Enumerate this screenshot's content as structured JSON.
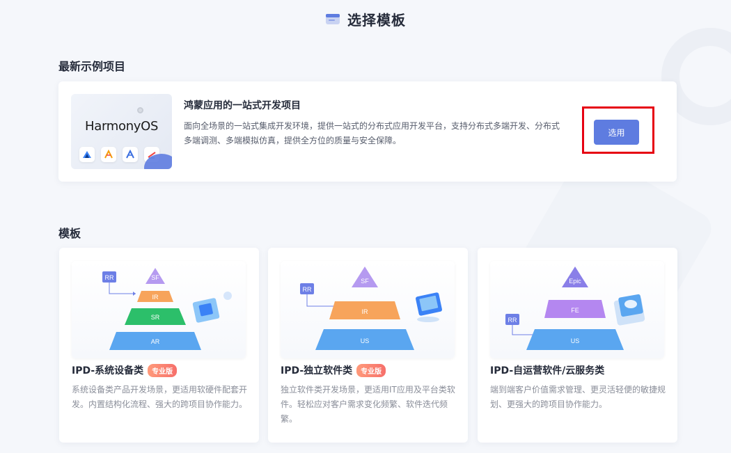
{
  "header": {
    "title": "选择模板",
    "icon": "template-icon"
  },
  "latest": {
    "section_title": "最新示例项目",
    "project": {
      "logo_text": "HarmonyOS",
      "title": "鸿蒙应用的一站式开发项目",
      "description": "面向全场景的一站式集成开发环境，提供一站式的分布式应用开发平台，支持分布式多端开发、分布式多端调测、多端模拟仿真，提供全方位的质量与安全保障。",
      "select_label": "选用"
    }
  },
  "templates": {
    "section_title": "模板",
    "items": [
      {
        "title": "IPD-系统设备类",
        "badge": "专业版",
        "description": "系统设备类产品开发场景，更适用软硬件配套开发。内置结构化流程、强大的跨项目协作能力。",
        "diagram": {
          "input": "RR",
          "levels": [
            "SF",
            "IR",
            "SR",
            "AR"
          ]
        }
      },
      {
        "title": "IPD-独立软件类",
        "badge": "专业版",
        "description": "独立软件类开发场景，更适用IT应用及平台类软件。轻松应对客户需求变化频繁、软件迭代频繁。",
        "diagram": {
          "input": "RR",
          "levels": [
            "SF",
            "IR",
            "US"
          ]
        }
      },
      {
        "title": "IPD-自运营软件/云服务类",
        "badge": "",
        "description": "端到端客户价值需求管理、更灵活轻便的敏捷规划、更强大的跨项目协作能力。",
        "diagram": {
          "input": "RR",
          "levels": [
            "Epic",
            "FE",
            "US"
          ]
        }
      }
    ]
  },
  "colors": {
    "primary": "#5e7ce0",
    "highlight_box": "#e60012",
    "badge_from": "#ff9a7a",
    "badge_to": "#f66f6a"
  }
}
